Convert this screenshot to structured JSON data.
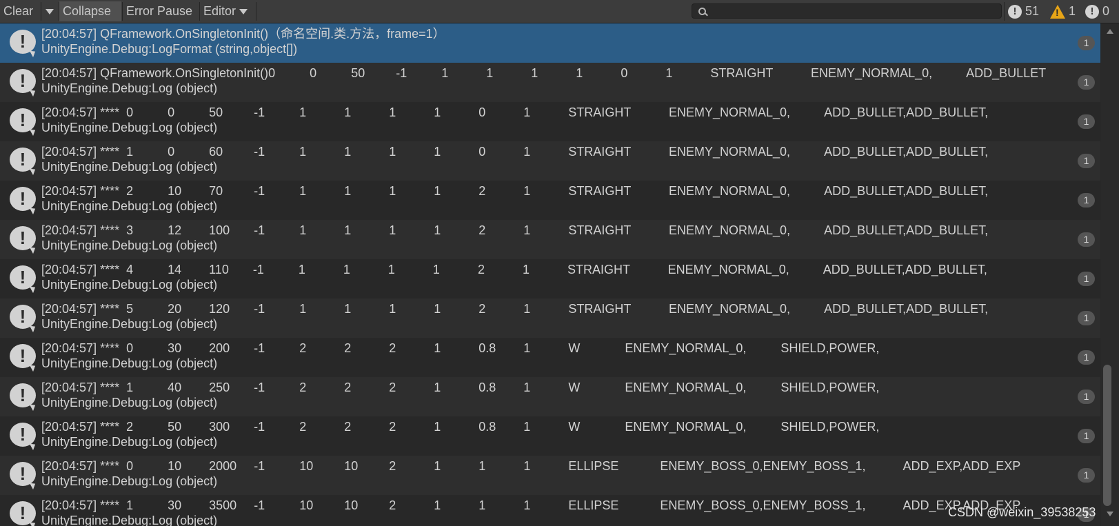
{
  "toolbar": {
    "clear_label": "Clear",
    "collapse_label": "Collapse",
    "error_pause_label": "Error Pause",
    "editor_label": "Editor",
    "search_value": "",
    "info_count": "51",
    "warning_count": "1",
    "error_count": "0"
  },
  "log_rows": [
    {
      "line1": "[20:04:57] QFramework.OnSingletonInit()（命名空间.类.方法，frame=1）",
      "line2": "UnityEngine.Debug:LogFormat (string,object[])",
      "count": "1"
    },
    {
      "line1": "[20:04:57] QFramework.OnSingletonInit()0          0          50         -1          1           1           1           1           0           1           STRAIGHT           ENEMY_NORMAL_0,          ADD_BULLET",
      "line2": "UnityEngine.Debug:Log (object)",
      "count": "1"
    },
    {
      "line1": "[20:04:57] ****  0          0          50         -1          1           1           1           1           0           1           STRAIGHT           ENEMY_NORMAL_0,          ADD_BULLET,ADD_BULLET,",
      "line2": "UnityEngine.Debug:Log (object)",
      "count": "1"
    },
    {
      "line1": "[20:04:57] ****  1          0          60         -1          1           1           1           1           0           1           STRAIGHT           ENEMY_NORMAL_0,          ADD_BULLET,ADD_BULLET,",
      "line2": "UnityEngine.Debug:Log (object)",
      "count": "1"
    },
    {
      "line1": "[20:04:57] ****  2          10        70         -1          1           1           1           1           2           1           STRAIGHT           ENEMY_NORMAL_0,          ADD_BULLET,ADD_BULLET,",
      "line2": "UnityEngine.Debug:Log (object)",
      "count": "1"
    },
    {
      "line1": "[20:04:57] ****  3          12        100       -1          1           1           1           1           2           1           STRAIGHT           ENEMY_NORMAL_0,          ADD_BULLET,ADD_BULLET,",
      "line2": "UnityEngine.Debug:Log (object)",
      "count": "1"
    },
    {
      "line1": "[20:04:57] ****  4          14        110       -1          1           1           1           1           2           1           STRAIGHT           ENEMY_NORMAL_0,          ADD_BULLET,ADD_BULLET,",
      "line2": "UnityEngine.Debug:Log (object)",
      "count": "1"
    },
    {
      "line1": "[20:04:57] ****  5          20        120       -1          1           1           1           1           2           1           STRAIGHT           ENEMY_NORMAL_0,          ADD_BULLET,ADD_BULLET,",
      "line2": "UnityEngine.Debug:Log (object)",
      "count": "1"
    },
    {
      "line1": "[20:04:57] ****  0          30        200       -1          2           2           2           1           0.8        1           W             ENEMY_NORMAL_0,          SHIELD,POWER,",
      "line2": "UnityEngine.Debug:Log (object)",
      "count": "1"
    },
    {
      "line1": "[20:04:57] ****  1          40        250       -1          2           2           2           1           0.8        1           W             ENEMY_NORMAL_0,          SHIELD,POWER,",
      "line2": "UnityEngine.Debug:Log (object)",
      "count": "1"
    },
    {
      "line1": "[20:04:57] ****  2          50        300       -1          2           2           2           1           0.8        1           W             ENEMY_NORMAL_0,          SHIELD,POWER,",
      "line2": "UnityEngine.Debug:Log (object)",
      "count": "1"
    },
    {
      "line1": "[20:04:57] ****  0          10        2000     -1          10         10         2           1           1           1           ELLIPSE            ENEMY_BOSS_0,ENEMY_BOSS_1,           ADD_EXP,ADD_EXP",
      "line2": "UnityEngine.Debug:Log (object)",
      "count": "1"
    },
    {
      "line1": "[20:04:57] ****  1          30        3500     -1          10         10         2           1           1           1           ELLIPSE            ENEMY_BOSS_0,ENEMY_BOSS_1,           ADD_EXP,ADD_EXP",
      "line2": "UnityEngine.Debug:Log (object)",
      "count": "1"
    }
  ],
  "watermark": "CSDN @weixin_39538253"
}
